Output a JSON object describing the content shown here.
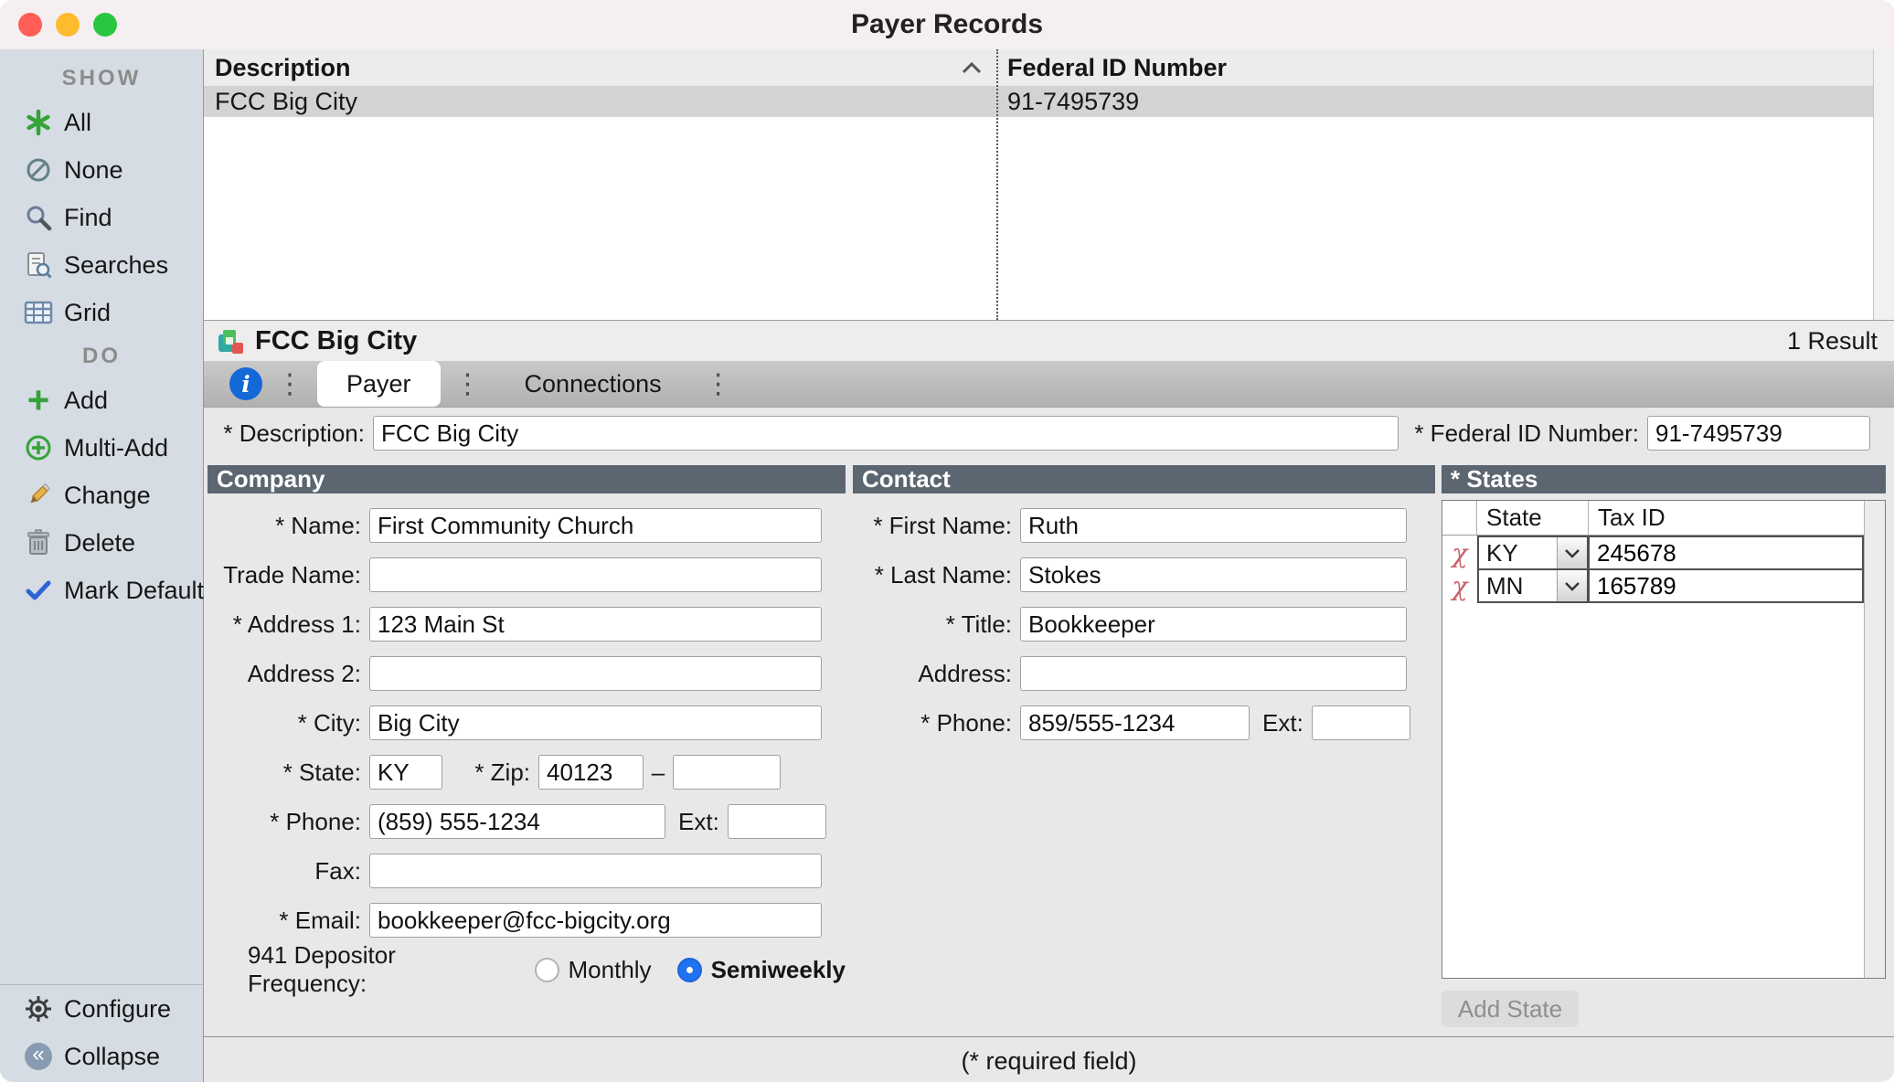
{
  "window": {
    "title": "Payer Records"
  },
  "icons": {
    "add": "+",
    "collapse": "«",
    "info": "i",
    "separator": "⋮",
    "delete_row": "χ"
  },
  "sidebar": {
    "show": {
      "title": "SHOW",
      "items": [
        {
          "label": "All"
        },
        {
          "label": "None"
        },
        {
          "label": "Find"
        },
        {
          "label": "Searches"
        },
        {
          "label": "Grid"
        }
      ]
    },
    "do": {
      "title": "DO",
      "items": [
        {
          "label": "Add"
        },
        {
          "label": "Multi-Add"
        },
        {
          "label": "Change"
        },
        {
          "label": "Delete"
        },
        {
          "label": "Mark Default"
        }
      ]
    },
    "footer": {
      "configure": "Configure",
      "collapse": "Collapse"
    }
  },
  "results": {
    "columns": {
      "description": "Description",
      "federal_id": "Federal ID Number"
    },
    "rows": [
      {
        "description": "FCC Big City",
        "federal_id": "91-7495739"
      }
    ],
    "count": "1 Result"
  },
  "record": {
    "title": "FCC Big City"
  },
  "tabs": {
    "payer": "Payer",
    "connections": "Connections"
  },
  "form": {
    "description_label": "* Description:",
    "description_value": "FCC Big City",
    "federal_id_label": "* Federal ID Number:",
    "federal_id_value": "91-7495739",
    "required_note": "(* required field)"
  },
  "company": {
    "header": "Company",
    "name_label": "* Name:",
    "name_value": "First Community Church",
    "trade_label": "Trade Name:",
    "address1_label": "* Address 1:",
    "address1_value": "123 Main St",
    "address2_label": "Address 2:",
    "city_label": "* City:",
    "city_value": "Big City",
    "state_label": "* State:",
    "state_value": "KY",
    "zip_label": "* Zip:",
    "zip_value": "40123",
    "zip_dash": "–",
    "phone_label": "* Phone:",
    "phone_value": "(859) 555-1234",
    "ext_label": "Ext:",
    "fax_label": "Fax:",
    "email_label": "* Email:",
    "email_value": "bookkeeper@fcc-bigcity.org",
    "freq_label": "941 Depositor Frequency:",
    "freq_options": [
      {
        "label": "Monthly",
        "selected": false
      },
      {
        "label": "Semiweekly",
        "selected": true
      }
    ]
  },
  "contact": {
    "header": "Contact",
    "first_label": "* First Name:",
    "first_value": "Ruth",
    "last_label": "* Last Name:",
    "last_value": "Stokes",
    "title_label": "* Title:",
    "title_value": "Bookkeeper",
    "address_label": "Address:",
    "phone_label": "* Phone:",
    "phone_value": "859/555-1234",
    "ext_label": "Ext:"
  },
  "states": {
    "header": "* States",
    "columns": {
      "state": "State",
      "tax_id": "Tax ID"
    },
    "rows": [
      {
        "state": "KY",
        "tax_id": "245678"
      },
      {
        "state": "MN",
        "tax_id": "165789"
      }
    ],
    "add_button": "Add State"
  }
}
